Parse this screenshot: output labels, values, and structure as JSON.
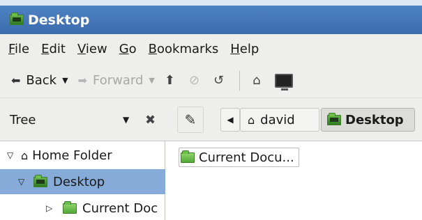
{
  "window": {
    "title": "Desktop"
  },
  "menu": [
    {
      "mnemonic": "F",
      "rest": "ile"
    },
    {
      "mnemonic": "E",
      "rest": "dit"
    },
    {
      "mnemonic": "V",
      "rest": "iew"
    },
    {
      "mnemonic": "G",
      "rest": "o"
    },
    {
      "mnemonic": "B",
      "rest": "ookmarks"
    },
    {
      "mnemonic": "H",
      "rest": "elp"
    }
  ],
  "toolbar": {
    "back_label": "Back",
    "forward_label": "Forward",
    "icons": {
      "back": "left-arrow-icon",
      "forward": "right-arrow-icon",
      "up": "up-arrow-icon",
      "stop": "stop-icon",
      "reload": "reload-icon",
      "home": "home-icon",
      "computer": "computer-icon"
    },
    "forward_disabled": true,
    "stop_disabled": true
  },
  "location": {
    "side_pane_mode": "Tree",
    "breadcrumbs": [
      "david",
      "Desktop"
    ],
    "active_crumb": "Desktop"
  },
  "tree": [
    {
      "label": "Home Folder",
      "expanded": true,
      "icon": "home-icon",
      "level": 0
    },
    {
      "label": "Desktop",
      "expanded": true,
      "icon": "desktop-folder-icon",
      "level": 1,
      "selected": true
    },
    {
      "label": "Current Doc",
      "expanded": false,
      "icon": "folder-icon",
      "level": 2
    }
  ],
  "files": [
    {
      "name": "Current Docu...",
      "icon": "folder-icon"
    }
  ],
  "colors": {
    "titlebar": "#3b6cae",
    "selection": "#86abd9",
    "chrome": "#eeeeec",
    "folder_green": "#53a838"
  }
}
